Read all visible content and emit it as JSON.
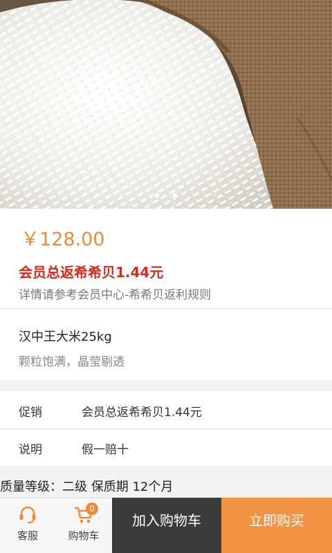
{
  "product": {
    "hero_image": "rice-grains-burlap-sack",
    "carousel_pages": 2,
    "price": "￥128.00",
    "rebate": "会员总返希希贝1.44元",
    "rebate_note": "详情请参考会员中心-希希贝返利规则",
    "name": "汉中王大米25kg",
    "description": "颗粒饱满，晶莹剔透"
  },
  "info": [
    {
      "key": "促销",
      "value": "会员总返希希贝1.44元"
    },
    {
      "key": "说明",
      "value": "假一赔十"
    }
  ],
  "spec": "质量等级：二级   保质期 12个月",
  "bottom": {
    "service_label": "客服",
    "service_icon": "headset-icon",
    "cart_label": "购物车",
    "cart_icon": "cart-icon",
    "cart_count": "0",
    "add_to_cart": "加入购物车",
    "buy_now": "立即购买"
  },
  "colors": {
    "price": "#f08a3a",
    "rebate": "#d62a1e",
    "add_button": "#3b3b3b",
    "buy_button": "#f29245"
  }
}
